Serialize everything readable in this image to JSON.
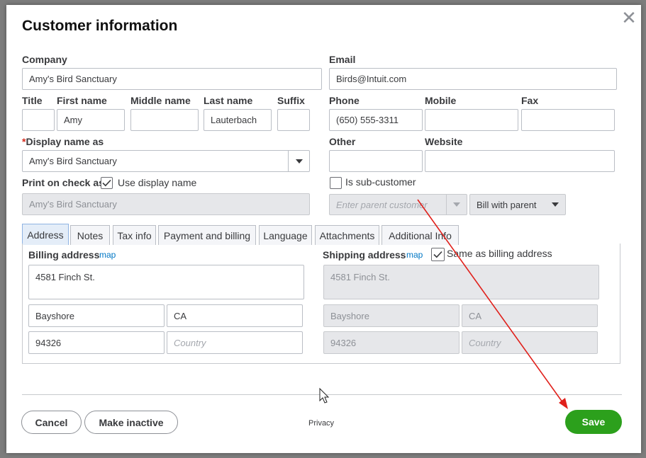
{
  "dialog": {
    "title": "Customer information",
    "close_glyph": "✕",
    "close_icon": "close-icon"
  },
  "fields": {
    "company": {
      "label": "Company",
      "value": "Amy's Bird Sanctuary"
    },
    "email": {
      "label": "Email",
      "value": "Birds@Intuit.com"
    },
    "title": {
      "label": "Title",
      "value": ""
    },
    "first_name": {
      "label": "First name",
      "value": "Amy"
    },
    "middle_name": {
      "label": "Middle name",
      "value": ""
    },
    "last_name": {
      "label": "Last name",
      "value": "Lauterbach"
    },
    "suffix": {
      "label": "Suffix",
      "value": ""
    },
    "phone": {
      "label": "Phone",
      "value": "(650) 555-3311"
    },
    "mobile": {
      "label": "Mobile",
      "value": ""
    },
    "fax": {
      "label": "Fax",
      "value": ""
    },
    "display_name": {
      "required_mark": "*",
      "label": "Display name as",
      "value": "Amy's Bird Sanctuary"
    },
    "other": {
      "label": "Other",
      "value": ""
    },
    "website": {
      "label": "Website",
      "value": ""
    },
    "print_on_check": {
      "label": "Print on check as",
      "checkbox_label": "Use display name",
      "checked": true,
      "value": "Amy's Bird Sanctuary"
    },
    "sub_customer": {
      "checkbox_label": "Is sub-customer",
      "checked": false,
      "parent_placeholder": "Enter parent customer",
      "bill_option": "Bill with parent"
    }
  },
  "tabs": [
    {
      "label": "Address",
      "active": true
    },
    {
      "label": "Notes",
      "active": false
    },
    {
      "label": "Tax info",
      "active": false
    },
    {
      "label": "Payment and billing",
      "active": false
    },
    {
      "label": "Language",
      "active": false
    },
    {
      "label": "Attachments",
      "active": false
    },
    {
      "label": "Additional Info",
      "active": false
    }
  ],
  "billing": {
    "label": "Billing address",
    "map_link": "map",
    "street": "4581 Finch St.",
    "city": "Bayshore",
    "state": "CA",
    "zip": "94326",
    "country_placeholder": "Country"
  },
  "shipping": {
    "label": "Shipping address",
    "map_link": "map",
    "same_as_billing_label": "Same as billing address",
    "same_checked": true,
    "street": "4581 Finch St.",
    "city": "Bayshore",
    "state": "CA",
    "zip": "94326",
    "country_placeholder": "Country"
  },
  "footer": {
    "cancel": "Cancel",
    "make_inactive": "Make inactive",
    "privacy": "Privacy",
    "save": "Save"
  },
  "colors": {
    "save_green": "#2ca01c",
    "link_blue": "#0077c5",
    "annotation_red": "#e0201b",
    "active_tab": "#e4edf8"
  }
}
